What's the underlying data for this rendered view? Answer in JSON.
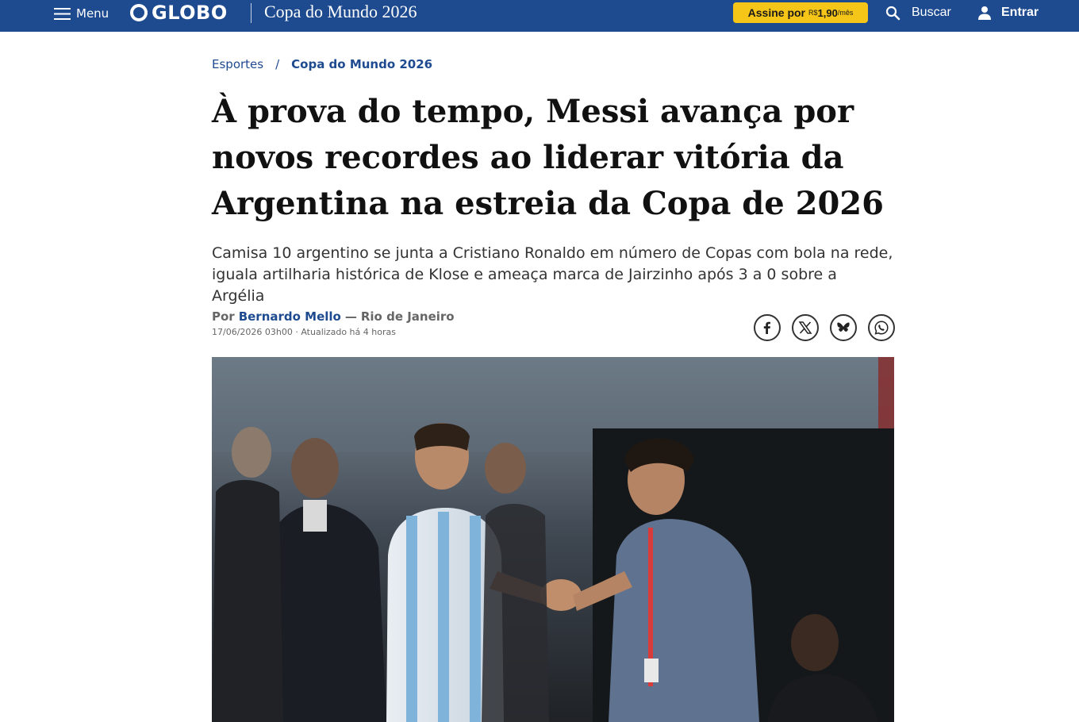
{
  "header": {
    "menu_label": "Menu",
    "logo_text": "GLOBO",
    "section_title": "Copa do Mundo 2026",
    "subscribe": {
      "prefix": "Assine por",
      "currency": "R$",
      "price": "1,90",
      "period": "/mês"
    },
    "search_label": "Buscar",
    "login_label": "Entrar"
  },
  "breadcrumb": {
    "items": [
      "Esportes",
      "Copa do Mundo 2026"
    ],
    "separator": "/"
  },
  "article": {
    "headline": "À prova do tempo, Messi avança por novos recordes ao liderar vitória da Argentina na estreia da Copa de 2026",
    "subtitle": "Camisa 10 argentino se junta a Cristiano Ronaldo em número de Copas com bola na rede, iguala artilharia histórica de Klose e ameaça marca de Jairzinho após 3 a 0 sobre a Argélia",
    "byline_prefix": "Por",
    "author": "Bernardo Mello",
    "byline_sep": "—",
    "location": "Rio de Janeiro",
    "dateline": "17/06/2026 03h00 · Atualizado há 4 horas"
  },
  "share_icons": [
    "facebook-icon",
    "x-icon",
    "bluesky-icon",
    "whatsapp-icon"
  ],
  "colors": {
    "brand_blue": "#1e4b8f",
    "subscribe_yellow": "#f5c518",
    "text_dark": "#111111",
    "text_muted": "#666666"
  }
}
